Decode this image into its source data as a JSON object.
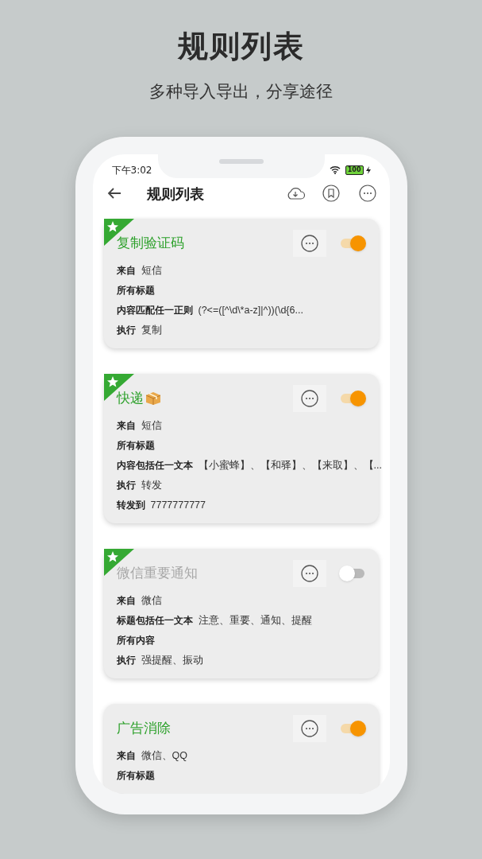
{
  "headline": "规则列表",
  "subheadline": "多种导入导出，分享途径",
  "status_bar": {
    "time": "下午3:02",
    "battery": "100"
  },
  "header": {
    "title": "规则列表"
  },
  "cards": [
    {
      "title": "复制验证码",
      "starred": true,
      "enabled": true,
      "rows": [
        {
          "label": "来自",
          "value": "短信"
        },
        {
          "label": "所有标题"
        },
        {
          "label": "内容匹配任一正则",
          "value": "(?<=([^\\d\\*a-z]|^))(\\d{6..."
        },
        {
          "label": "执行",
          "value": "复制"
        }
      ]
    },
    {
      "title": "快递",
      "package_emoji": true,
      "starred": true,
      "enabled": true,
      "rows": [
        {
          "label": "来自",
          "value": "短信"
        },
        {
          "label": "所有标题"
        },
        {
          "label": "内容包括任一文本",
          "value": "【小蜜蜂】、【和驿】、【来取】、【..."
        },
        {
          "label": "执行",
          "value": "转发"
        },
        {
          "label": "转发到",
          "value": "7777777777"
        }
      ]
    },
    {
      "title": "微信重要通知",
      "starred": true,
      "enabled": false,
      "rows": [
        {
          "label": "来自",
          "value": "微信"
        },
        {
          "label": "标题包括任一文本",
          "value": "注意、重要、通知、提醒"
        },
        {
          "label": "所有内容"
        },
        {
          "label": "执行",
          "value": "强提醒、振动"
        }
      ]
    },
    {
      "title": "广告消除",
      "starred": false,
      "enabled": true,
      "rows": [
        {
          "label": "来自",
          "value": "微信、QQ"
        },
        {
          "label": "所有标题"
        }
      ]
    }
  ]
}
